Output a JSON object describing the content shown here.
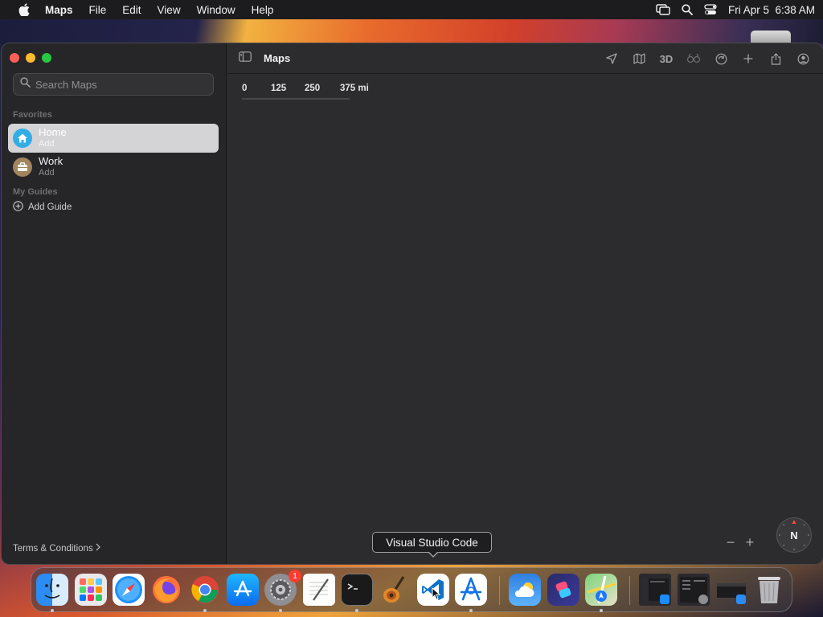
{
  "menubar": {
    "app_name": "Maps",
    "items": [
      "File",
      "Edit",
      "View",
      "Window",
      "Help"
    ],
    "datetime": "Fri Apr 5  6:38 AM"
  },
  "window": {
    "title": "Maps",
    "sidebar": {
      "search_placeholder": "Search Maps",
      "favorites_label": "Favorites",
      "favorites": [
        {
          "title": "Home",
          "subtitle": "Add",
          "icon": "house-icon",
          "color": "#32ade6"
        },
        {
          "title": "Work",
          "subtitle": "Add",
          "icon": "briefcase-icon",
          "color": "#a2845e"
        }
      ],
      "guides_label": "My Guides",
      "add_guide_label": "Add Guide",
      "terms_label": "Terms & Conditions"
    },
    "toolbar": {
      "three_d_label": "3D",
      "icons": [
        "location-arrow-icon",
        "map-mode-icon",
        "3d-toggle",
        "look-around-icon",
        "traffic-icon",
        "add-icon",
        "share-icon",
        "account-icon"
      ]
    },
    "map": {
      "scale_labels": [
        "0",
        "125",
        "250",
        "375 mi"
      ],
      "zoom_out": "−",
      "zoom_in": "+",
      "compass_label": "N"
    }
  },
  "tooltip": {
    "text": "Visual Studio Code"
  },
  "dock": {
    "badge_count": "1",
    "apps": [
      "finder",
      "launchpad",
      "safari",
      "firefox",
      "chrome",
      "app-store",
      "system-settings",
      "textedit",
      "terminal",
      "garageband",
      "vscode",
      "xcode-instruments",
      "weather",
      "shortcuts",
      "maps",
      "window-1",
      "window-2",
      "window-3",
      "trash"
    ]
  },
  "colors": {
    "accent_selected": "#d4d4d6",
    "close": "#ff5f57",
    "minimize": "#febc2e",
    "maximize": "#28c840"
  }
}
